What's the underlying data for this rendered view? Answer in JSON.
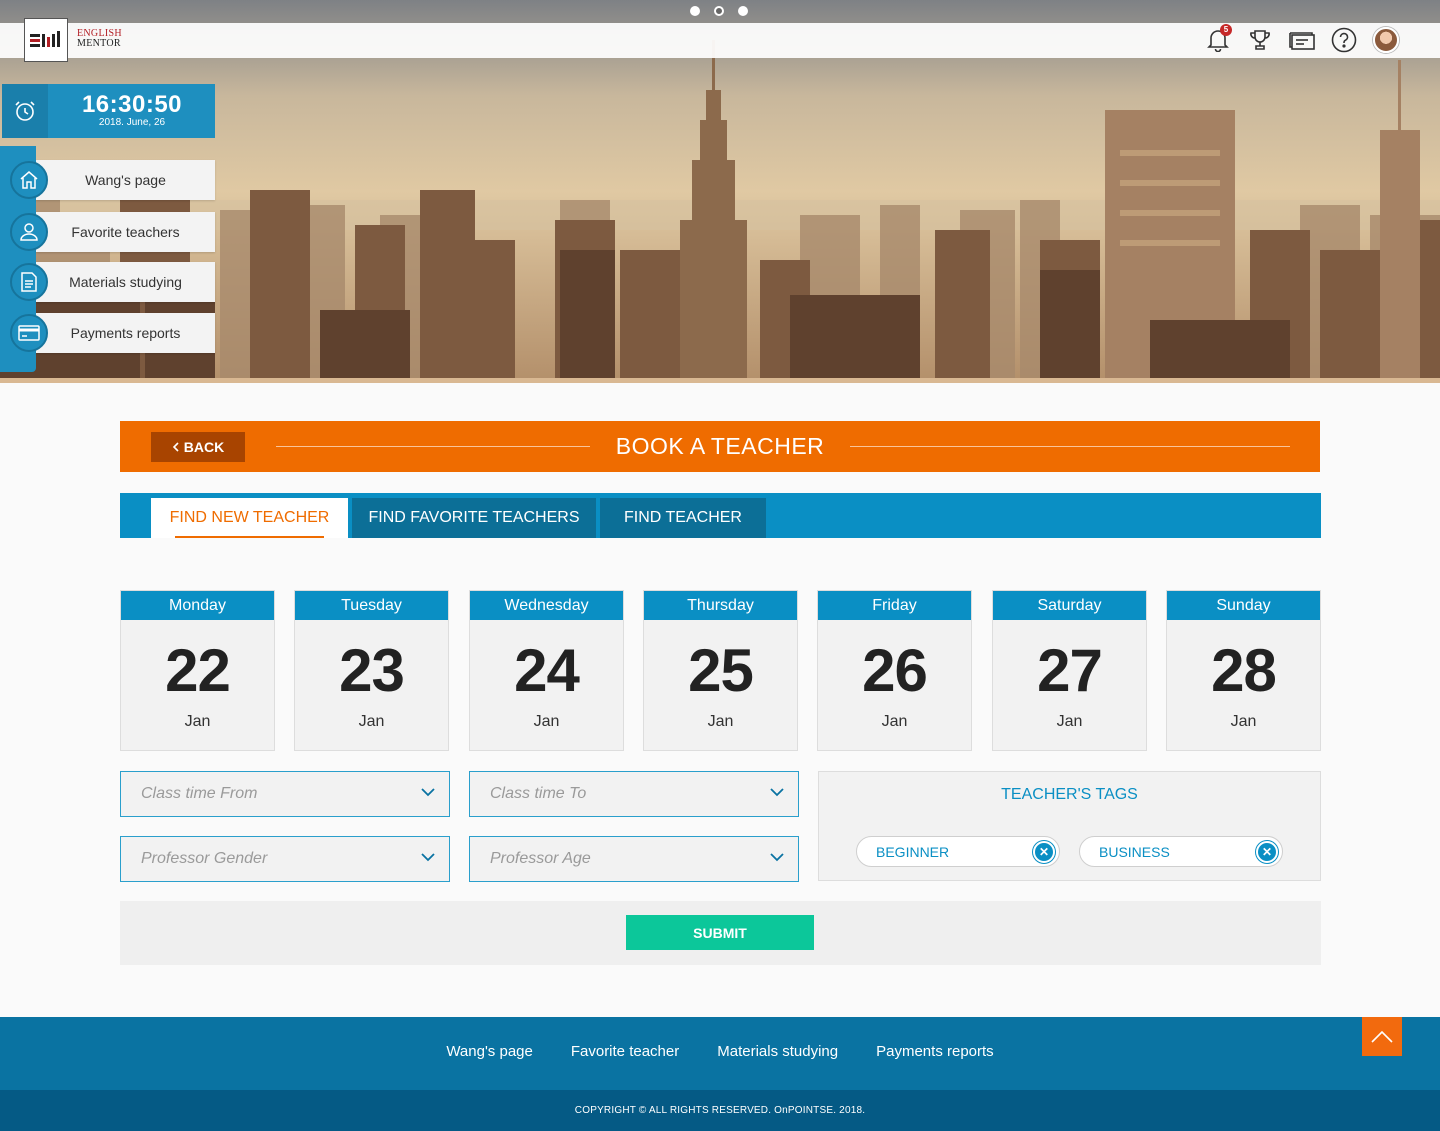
{
  "header": {
    "carousel_dots": 3,
    "carousel_active": 1,
    "logo_text_line1": "ENGLISH",
    "logo_text_line2": "MENTOR",
    "notification_count": "5",
    "icons": [
      "bell-icon",
      "trophy-icon",
      "ticket-icon",
      "help-icon",
      "avatar"
    ]
  },
  "clock": {
    "time": "16:30:50",
    "date": "2018. June, 26"
  },
  "sidebar": {
    "items": [
      {
        "label": "Wang's page",
        "icon": "home-icon"
      },
      {
        "label": "Favorite teachers",
        "icon": "user-icon"
      },
      {
        "label": "Materials studying",
        "icon": "document-icon"
      },
      {
        "label": "Payments reports",
        "icon": "credit-card-icon"
      }
    ]
  },
  "main": {
    "back_label": "BACK",
    "title": "BOOK A TEACHER",
    "tabs": [
      {
        "label": "FIND NEW TEACHER",
        "active": true
      },
      {
        "label": "FIND FAVORITE TEACHERS",
        "active": false
      },
      {
        "label": "FIND TEACHER",
        "active": false
      }
    ],
    "days": [
      {
        "weekday": "Monday",
        "day": "22",
        "month": "Jan"
      },
      {
        "weekday": "Tuesday",
        "day": "23",
        "month": "Jan"
      },
      {
        "weekday": "Wednesday",
        "day": "24",
        "month": "Jan"
      },
      {
        "weekday": "Thursday",
        "day": "25",
        "month": "Jan"
      },
      {
        "weekday": "Friday",
        "day": "26",
        "month": "Jan"
      },
      {
        "weekday": "Saturday",
        "day": "27",
        "month": "Jan"
      },
      {
        "weekday": "Sunday",
        "day": "28",
        "month": "Jan"
      }
    ],
    "filters": {
      "class_time_from": "Class time From",
      "class_time_to": "Class time To",
      "professor_gender": "Professor Gender",
      "professor_age": "Professor Age"
    },
    "tags_title": "TEACHER'S TAGS",
    "tags": [
      "BEGINNER",
      "BUSINESS"
    ],
    "submit_label": "SUBMIT"
  },
  "footer": {
    "links": [
      "Wang's page",
      "Favorite teacher",
      "Materials studying",
      "Payments reports"
    ],
    "copyright": "COPYRIGHT © ALL RIGHTS RESERVED. OnPOINTSE. 2018."
  },
  "colors": {
    "primary_blue": "#0a8fc4",
    "orange": "#ef6c00",
    "submit_green": "#0cc79a",
    "footer_blue": "#0a73a2"
  }
}
